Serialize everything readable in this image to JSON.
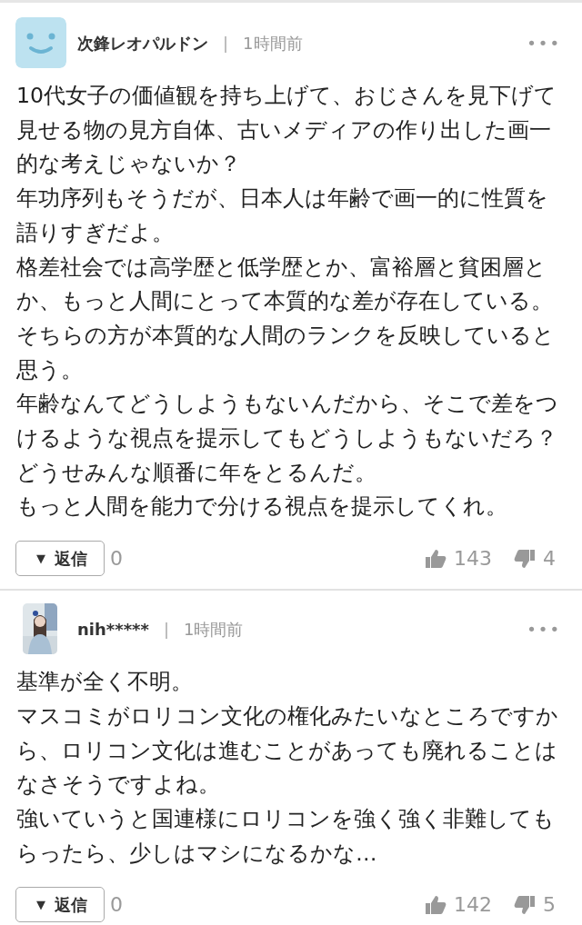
{
  "comments": [
    {
      "avatar": {
        "kind": "default"
      },
      "author": "次鋒レオパルドン",
      "separator": "|",
      "time": "1時間前",
      "more": "•••",
      "lines": [
        "10代女子の価値観を持ち上げて、おじさんを見下げて見せる物の見方自体、古いメディアの作り出した画一的な考えじゃないか？",
        "年功序列もそうだが、日本人は年齢で画一的に性質を語りすぎだよ。",
        "格差社会では高学歴と低学歴とか、富裕層と貧困層とか、もっと人間にとって本質的な差が存在している。そちらの方が本質的な人間のランクを反映していると思う。",
        "年齢なんてどうしようもないんだから、そこで差をつけるような視点を提示してもどうしようもないだろ？どうせみんな順番に年をとるんだ。",
        "もっと人間を能力で分ける視点を提示してくれ。"
      ],
      "reply_caret": "▼",
      "reply_label": "返信",
      "reply_count": "0",
      "likes": "143",
      "dislikes": "4"
    },
    {
      "author": "nih*****",
      "separator": "|",
      "time": "1時間前",
      "more": "•••",
      "lines": [
        "基準が全く不明。",
        "マスコミがロリコン文化の権化みたいなところですから、ロリコン文化は進むことがあっても廃れることはなさそうですよね。",
        "強いていうと国連様にロリコンを強く強く非難してもらったら、少しはマシになるかな…"
      ],
      "reply_caret": "▼",
      "reply_label": "返信",
      "reply_count": "0",
      "likes": "142",
      "dislikes": "5"
    }
  ]
}
